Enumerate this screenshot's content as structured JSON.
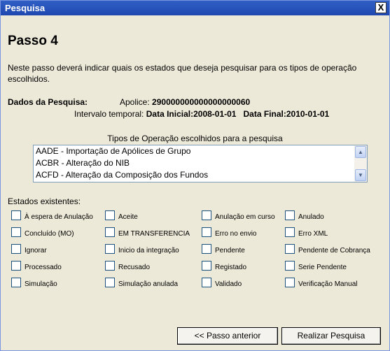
{
  "window": {
    "title": "Pesquisa",
    "close_label": "X"
  },
  "step": {
    "title": "Passo 4"
  },
  "intro": {
    "text": "Neste passo deverá indicar quais os estados que deseja pesquisar para os tipos de operação escolhidos."
  },
  "search_data": {
    "label": "Dados da Pesquisa:",
    "apolice_label": "Apolice:",
    "apolice_value": "290000000000000000060",
    "interval_label": "Intervalo temporal:",
    "initial_date_label": "Data Inicial:",
    "initial_date_value": "2008-01-01",
    "final_date_label": "Data Final:",
    "final_date_value": "2010-01-01"
  },
  "operation_types": {
    "caption": "Tipos de Operação escolhidos para a pesquisa",
    "items": [
      "AADE - Importação de Apólices de Grupo",
      "ACBR - Alteração do NIB",
      "ACFD - Alteração da Composição dos Fundos"
    ]
  },
  "states": {
    "label": "Estados existentes:",
    "items": [
      "À espera de Anulação",
      "Aceite",
      "Anulação em curso",
      "Anulado",
      "Concluído (MO)",
      "EM TRANSFERENCIA",
      "Erro no envio",
      "Erro XML",
      "Ignorar",
      "Inicio da integração",
      "Pendente",
      "Pendente de Cobrança",
      "Processado",
      "Recusado",
      "Registado",
      "Serie Pendente",
      "Simulação",
      "Simulação anulada",
      "Validado",
      "Verificação Manual"
    ]
  },
  "buttons": {
    "previous": "<<   Passo anterior",
    "search": "Realizar Pesquisa"
  }
}
